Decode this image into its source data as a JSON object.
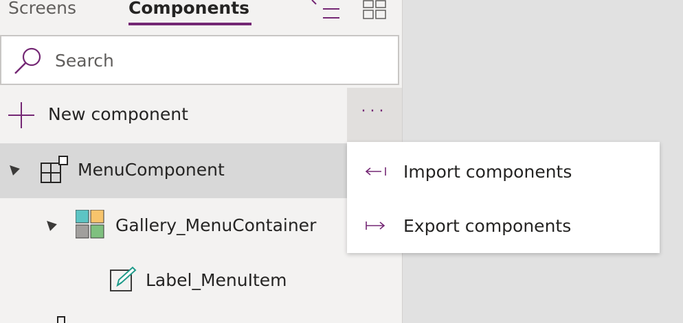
{
  "tabs": {
    "screens": "Screens",
    "components": "Components"
  },
  "toolbar": {
    "icons": [
      "sort-icon",
      "grid-view-icon"
    ]
  },
  "search": {
    "placeholder": "Search",
    "value": ""
  },
  "actions": {
    "new_component": "New component",
    "more_label": "···"
  },
  "tree": {
    "menu_component": "MenuComponent",
    "gallery": "Gallery_MenuContainer",
    "label_item": "Label_MenuItem"
  },
  "context_menu": {
    "import": "Import components",
    "export": "Export components"
  },
  "colors": {
    "accent": "#742774",
    "selected_row": "#d8d8d8",
    "panel": "#f3f2f1",
    "canvas": "#e1e1e1"
  }
}
